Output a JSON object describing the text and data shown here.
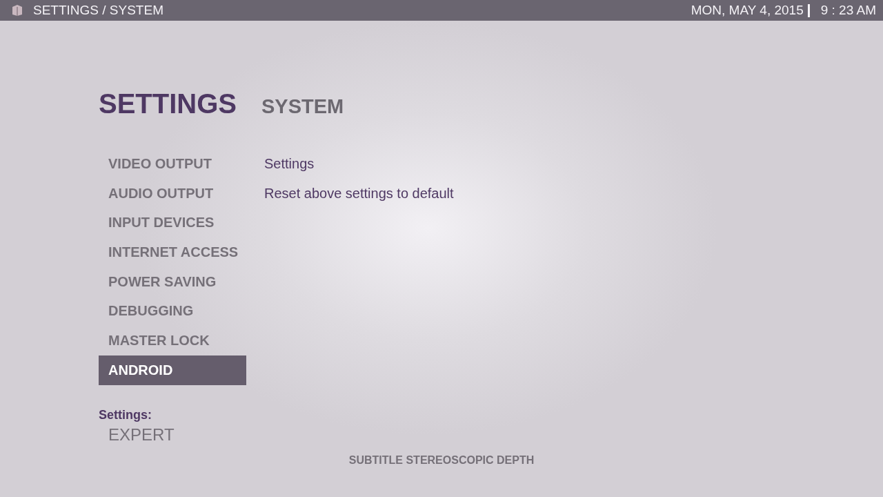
{
  "top_bar": {
    "breadcrumb": "SETTINGS / SYSTEM",
    "date": "MON, MAY 4, 2015",
    "time": "9 : 23 AM"
  },
  "header": {
    "title": "SETTINGS",
    "subtitle": "SYSTEM"
  },
  "menu": [
    {
      "label": "VIDEO OUTPUT",
      "selected": false
    },
    {
      "label": "AUDIO OUTPUT",
      "selected": false
    },
    {
      "label": "INPUT DEVICES",
      "selected": false
    },
    {
      "label": "INTERNET ACCESS",
      "selected": false
    },
    {
      "label": "POWER SAVING",
      "selected": false
    },
    {
      "label": "DEBUGGING",
      "selected": false
    },
    {
      "label": "MASTER LOCK",
      "selected": false
    },
    {
      "label": "ANDROID",
      "selected": true
    }
  ],
  "options": [
    "Settings",
    "Reset above settings to default"
  ],
  "settings_level": {
    "label": "Settings:",
    "value": "EXPERT"
  },
  "footer_hint": "SUBTITLE STEREOSCOPIC DEPTH"
}
